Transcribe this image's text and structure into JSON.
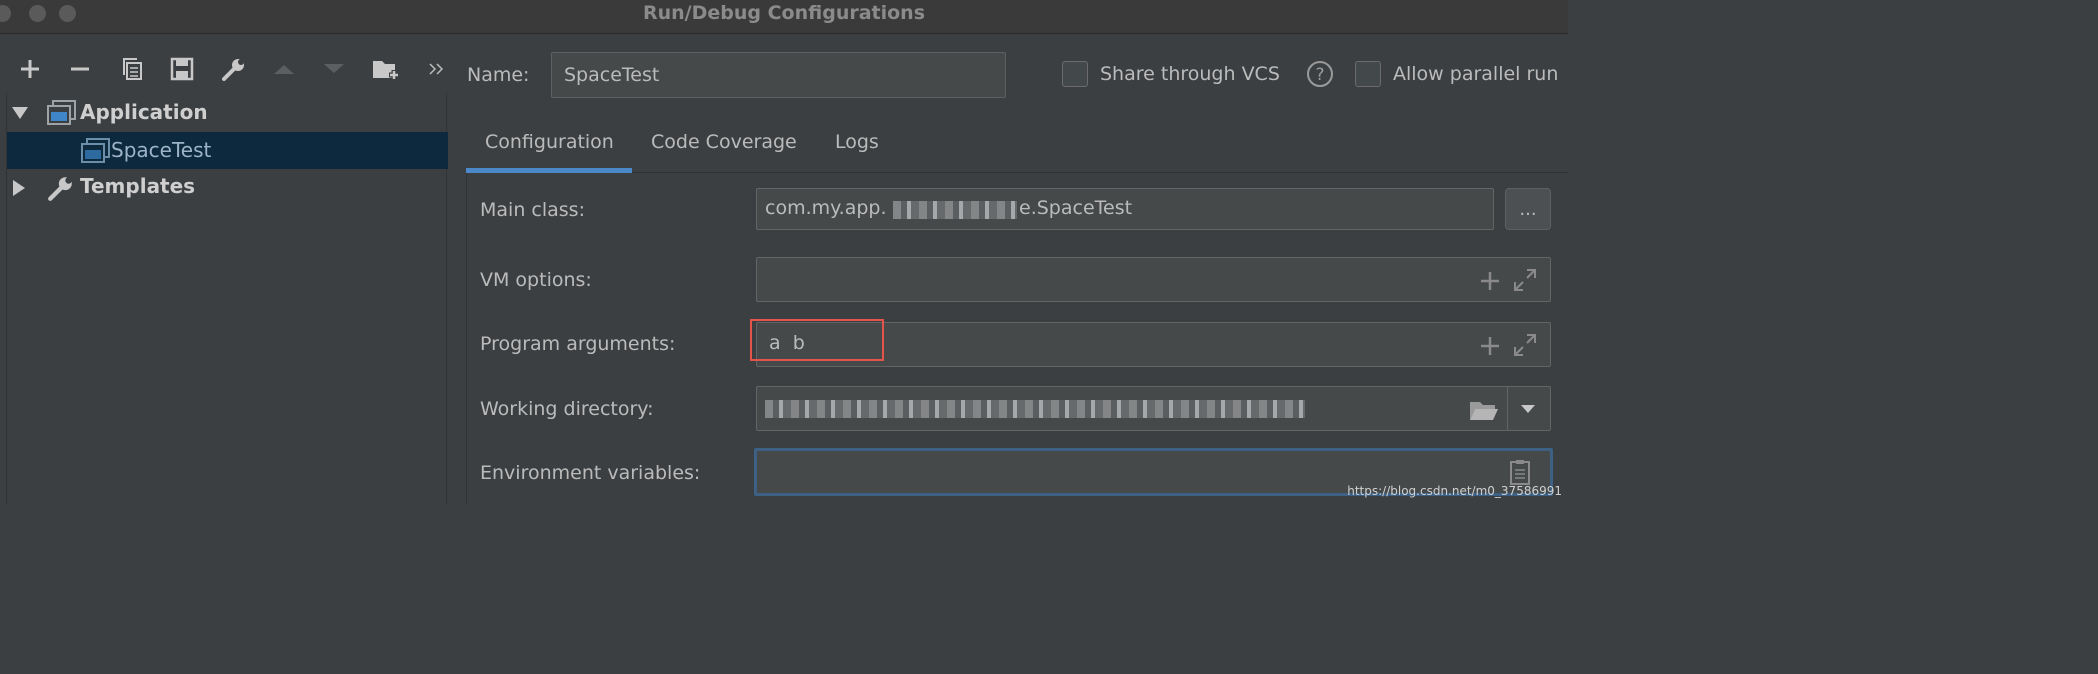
{
  "window": {
    "title": "Run/Debug Configurations"
  },
  "tree": {
    "items": [
      {
        "label": "Application",
        "expanded": true
      },
      {
        "label": "SpaceTest",
        "selected": true
      },
      {
        "label": "Templates",
        "expanded": false
      }
    ]
  },
  "header": {
    "name_label": "Name:",
    "name_value": "SpaceTest",
    "share_vcs_label": "Share through VCS",
    "help_glyph": "?",
    "allow_parallel_label": "Allow parallel run"
  },
  "tabs": [
    {
      "label": "Configuration",
      "active": true
    },
    {
      "label": "Code Coverage"
    },
    {
      "label": "Logs"
    }
  ],
  "form": {
    "main_class_label": "Main class:",
    "main_class_value": "com.my.app.",
    "main_class_suffix": "e.SpaceTest",
    "browse_label": "...",
    "vm_options_label": "VM options:",
    "vm_options_value": "",
    "program_args_label": "Program arguments:",
    "program_args_value": "a  b",
    "working_dir_label": "Working directory:",
    "working_dir_value": "",
    "env_vars_label": "Environment variables:",
    "env_vars_value": ""
  },
  "watermark": "https://blog.csdn.net/m0_37586991",
  "colors": {
    "accent": "#4a88c7",
    "selection": "#0d293e",
    "highlight": "#e5544b"
  },
  "icons": [
    "add-icon",
    "remove-icon",
    "copy-icon",
    "save-icon",
    "wrench-icon",
    "move-up-icon",
    "move-down-icon",
    "new-folder-icon",
    "more-icon",
    "help-icon",
    "expand-icon",
    "folder-icon",
    "dropdown-icon",
    "clipboard-icon"
  ]
}
